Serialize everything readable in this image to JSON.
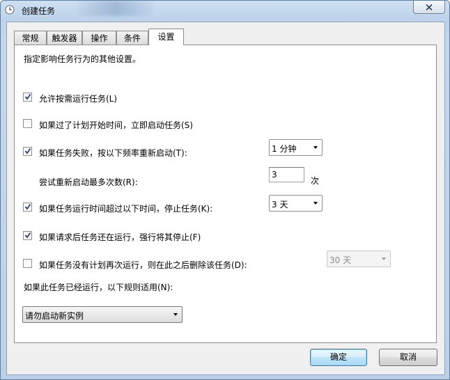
{
  "window": {
    "title": "创建任务"
  },
  "tabs": [
    {
      "label": "常规"
    },
    {
      "label": "触发器"
    },
    {
      "label": "操作"
    },
    {
      "label": "条件"
    },
    {
      "label": "设置"
    }
  ],
  "settings": {
    "description": "指定影响任务行为的其他设置。",
    "allow_on_demand": {
      "label": "允许按需运行任务(L)",
      "checked": true
    },
    "start_if_missed": {
      "label": "如果过了计划开始时间，立即启动任务(S)",
      "checked": false
    },
    "restart_on_fail": {
      "label": "如果任务失败，按以下频率重新启动(T):",
      "checked": true,
      "interval": "1 分钟"
    },
    "restart_attempts": {
      "label": "尝试重新启动最多次数(R):",
      "value": "3",
      "unit": "次"
    },
    "stop_if_runs_longer": {
      "label": "如果任务运行时间超过以下时间，停止任务(K):",
      "checked": true,
      "duration": "3 天"
    },
    "force_stop": {
      "label": "如果请求后任务还在运行，强行将其停止(F)",
      "checked": true
    },
    "delete_if_not_scheduled": {
      "label": "如果任务没有计划再次运行，则在此之后删除该任务(D):",
      "checked": false,
      "duration": "30 天"
    },
    "running_rule": {
      "label": "如果此任务已经运行，以下规则适用(N):",
      "value": "请勿启动新实例"
    }
  },
  "buttons": {
    "ok": "确定",
    "cancel": "取消"
  }
}
